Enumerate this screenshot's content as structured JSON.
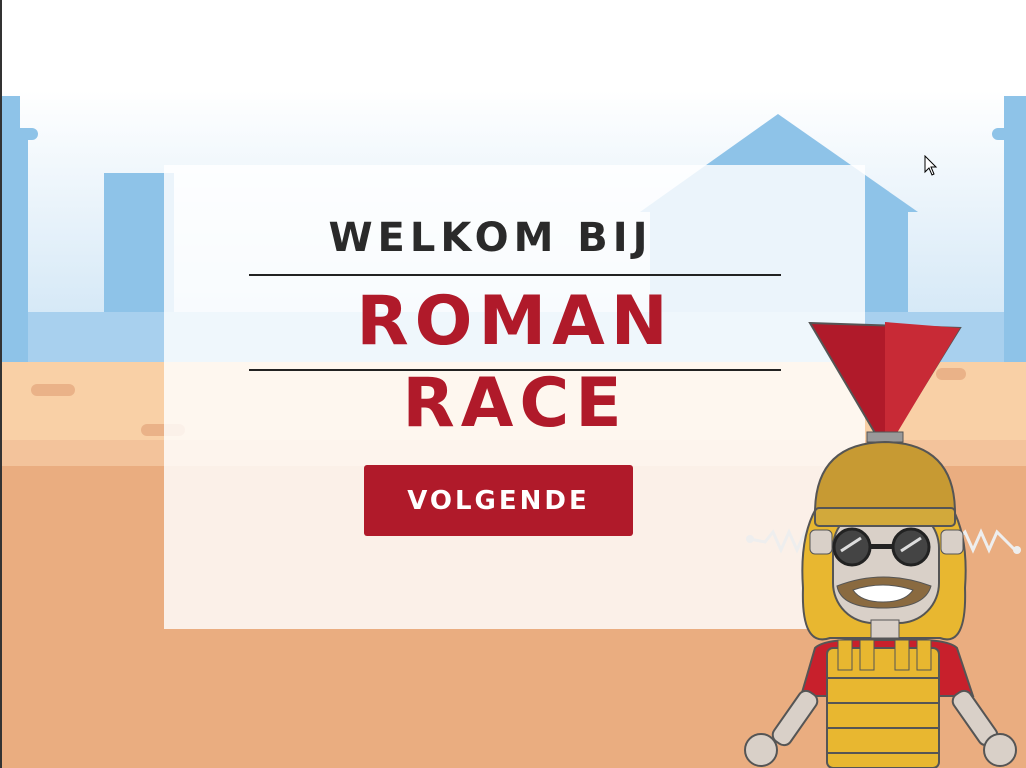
{
  "screen": {
    "welcome_text": "WELKOM BIJ",
    "game_title": "ROMAN RACE",
    "next_button_label": "VOLGENDE"
  },
  "colors": {
    "accent_red": "#b01a2a",
    "sky_blue": "#8ec3e8",
    "sand": "#eaad80",
    "wall": "#f9d0a6"
  },
  "icons": {
    "cursor": "mouse-pointer-icon",
    "mascot": "roman-soldier-robot"
  }
}
